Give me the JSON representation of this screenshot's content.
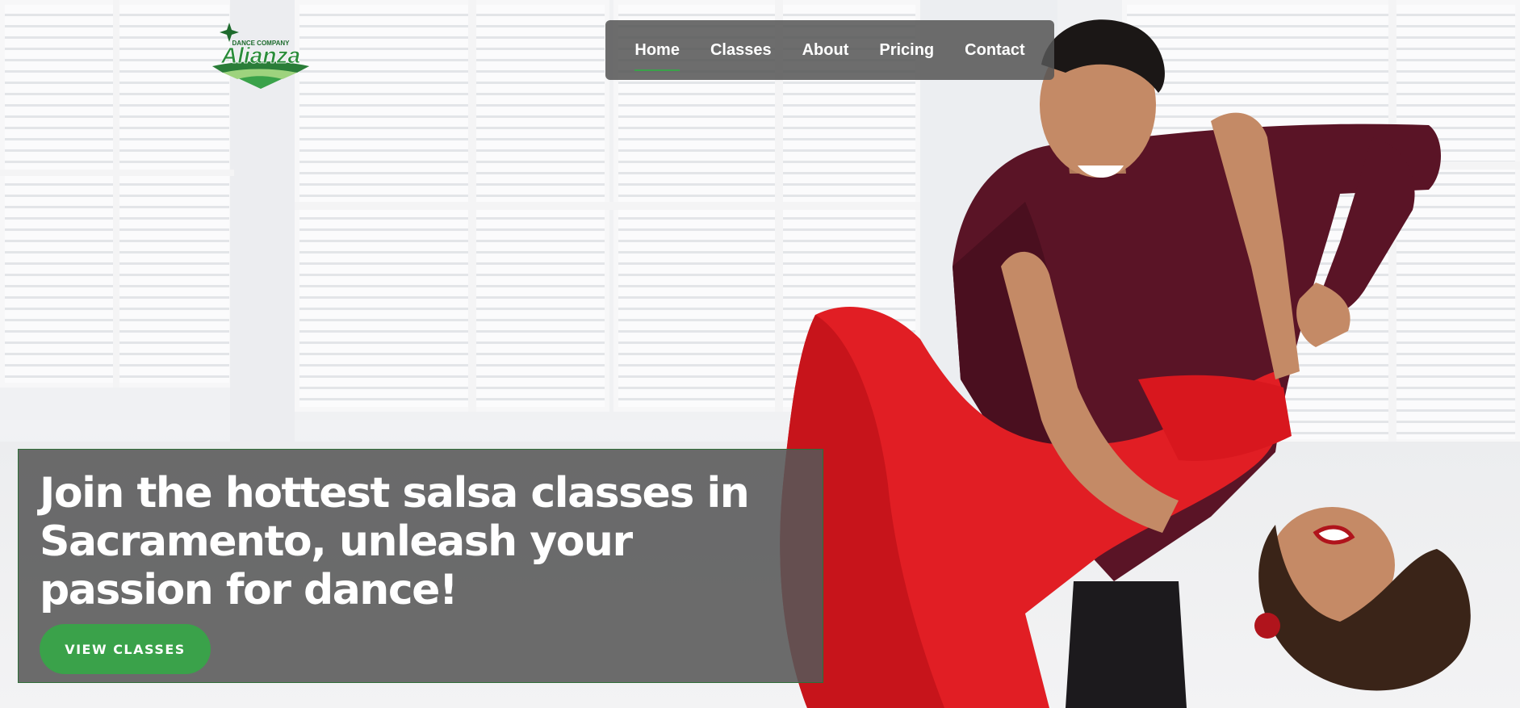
{
  "brand": {
    "name": "Alianza",
    "tagline": "DANCE COMPANY",
    "accent_color": "#3aa24a"
  },
  "nav": {
    "items": [
      {
        "label": "Home",
        "active": true
      },
      {
        "label": "Classes",
        "active": false
      },
      {
        "label": "About",
        "active": false
      },
      {
        "label": "Pricing",
        "active": false
      },
      {
        "label": "Contact",
        "active": false
      }
    ]
  },
  "hero": {
    "title": "Join the hottest salsa classes in Sacramento, unleash your passion for dance!",
    "cta_label": "VIEW CLASSES",
    "image_subject": "couple-dancing-salsa"
  }
}
